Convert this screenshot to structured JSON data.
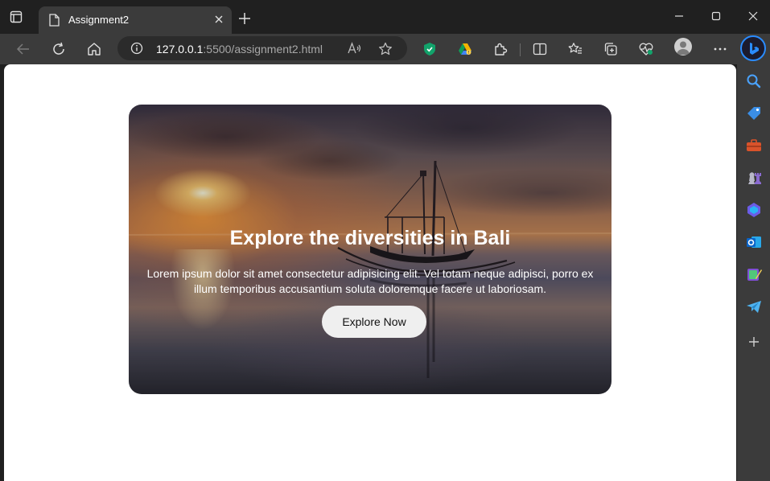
{
  "browser": {
    "tab": {
      "title": "Assignment2"
    },
    "address": {
      "host": "127.0.0.1",
      "rest": ":5500/assignment2.html"
    },
    "toolbar_icons": [
      "back-icon",
      "refresh-icon",
      "home-icon",
      "read-aloud-icon",
      "favorite-icon",
      "shield-extension-icon",
      "drive-extension-icon",
      "extensions-icon",
      "split-screen-icon",
      "favorites-icon",
      "collections-icon",
      "performance-icon",
      "profile-avatar",
      "more-icon"
    ],
    "sidebar_icons": [
      "search-icon",
      "shopping-icon",
      "tools-icon",
      "games-icon",
      "copilot-icon",
      "outlook-icon",
      "designer-icon",
      "telegram-icon",
      "add-icon"
    ]
  },
  "hero": {
    "title": "Explore the diversities in Bali",
    "text": "Lorem ipsum dolor sit amet consectetur adipisicing elit. Vel totam neque adipisci, porro ex illum temporibus accusantium soluta doloremque facere ut laboriosam.",
    "button_label": "Explore Now"
  }
}
